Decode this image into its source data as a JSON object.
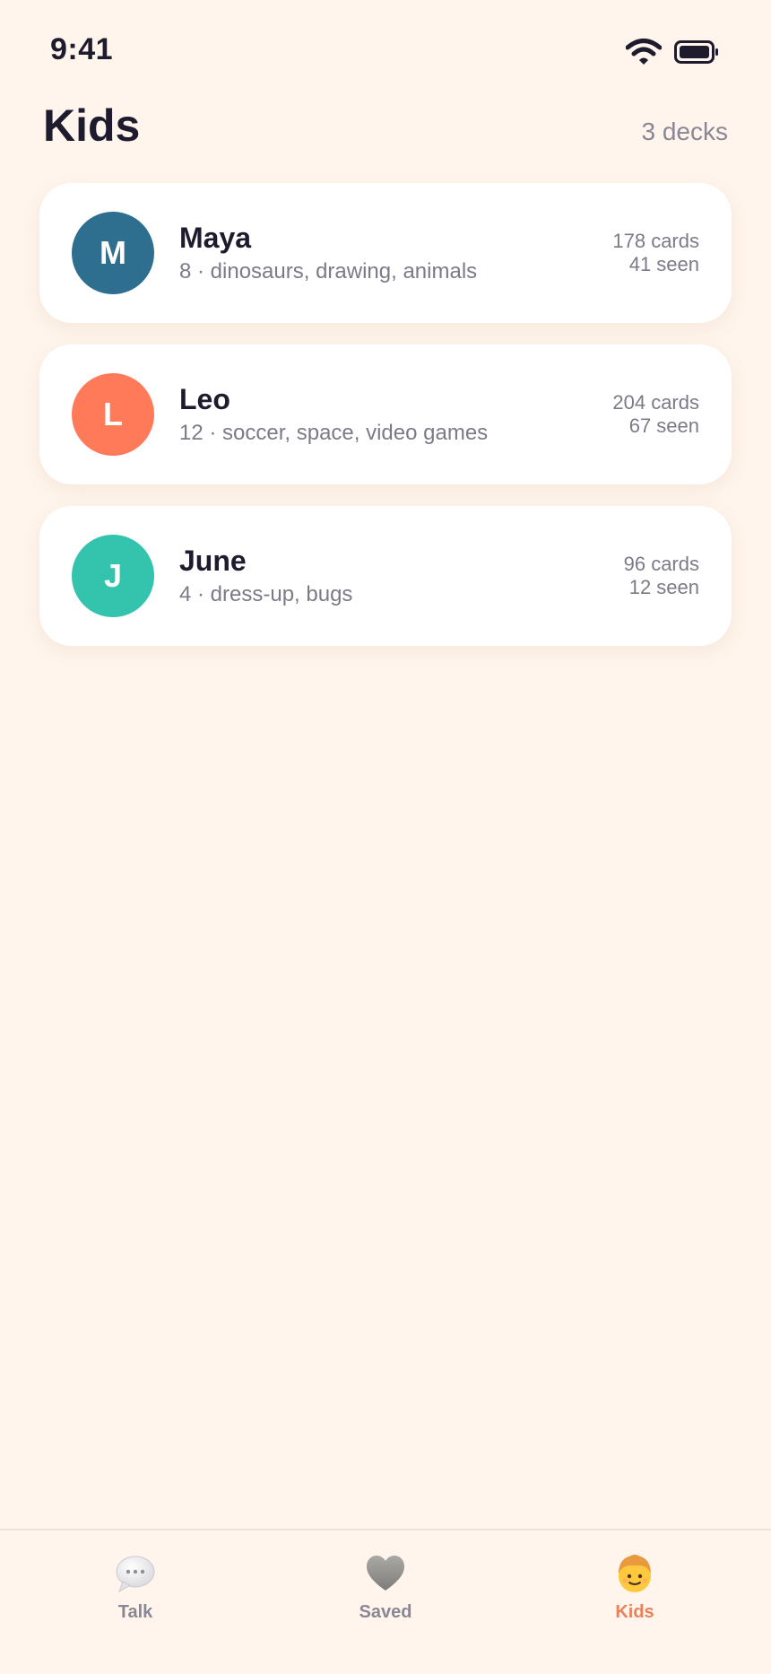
{
  "status_bar": {
    "time": "9:41"
  },
  "header": {
    "title": "Kids",
    "deck_count": "3 decks"
  },
  "kids": [
    {
      "initial": "M",
      "name": "Maya",
      "details": "8 · dinosaurs, drawing, animals",
      "cards": "178 cards",
      "seen": "41 seen",
      "color": "#2E6E8E"
    },
    {
      "initial": "L",
      "name": "Leo",
      "details": "12 · soccer, space, video games",
      "cards": "204 cards",
      "seen": "67 seen",
      "color": "#FF7A59"
    },
    {
      "initial": "J",
      "name": "June",
      "details": "4 · dress-up, bugs",
      "cards": "96 cards",
      "seen": "12 seen",
      "color": "#34C3AD"
    }
  ],
  "tab_bar": {
    "tabs": [
      {
        "label": "Talk",
        "icon": "speech-bubble-icon",
        "active": false
      },
      {
        "label": "Saved",
        "icon": "heart-icon",
        "active": false
      },
      {
        "label": "Kids",
        "icon": "child-icon",
        "active": true
      }
    ],
    "active_color": "#E8825C"
  }
}
